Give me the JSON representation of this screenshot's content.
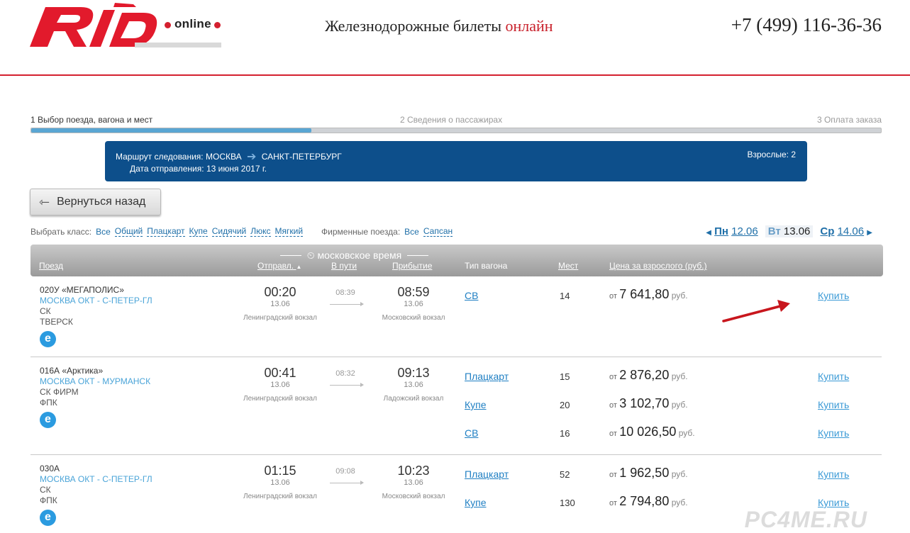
{
  "header": {
    "logo_text": "RЖD",
    "logo_online": "online",
    "tagline_main": "Железнодорожные билеты",
    "tagline_accent": "онлайн",
    "phone": "+7 (499) 116-36-36",
    "accent_color": "#d4202f"
  },
  "steps": {
    "step1": "1 Выбор поезда, вагона и мест",
    "step2": "2 Сведения о пассажирах",
    "step3": "3 Оплата заказа",
    "progress": 0.33
  },
  "route": {
    "label": "Маршрут следования:",
    "from": "МОСКВА",
    "to": "САНКТ-ПЕТЕРБУРГ",
    "date_label": "Дата отправления:",
    "date": "13 июня 2017 г.",
    "pax_label": "Взрослые:",
    "pax": "2"
  },
  "back_button": {
    "label": "Вернуться назад"
  },
  "filters": {
    "class_label": "Выбрать класс:",
    "classes": [
      "Все",
      "Общий",
      "Плацкарт",
      "Купе",
      "Сидячий",
      "Люкс",
      "Мягкий"
    ],
    "branded_label": "Фирменные поезда:",
    "branded": [
      "Все",
      "Сапсан"
    ]
  },
  "dates": {
    "prev_day": "Пн",
    "prev_date": "12.06",
    "cur_day": "Вт",
    "cur_date": "13.06",
    "next_day": "Ср",
    "next_date": "14.06"
  },
  "table": {
    "moscow_time": "московское время",
    "col_train": "Поезд",
    "col_depart": "Отправл.",
    "col_travel": "В пути",
    "col_arrive": "Прибытие",
    "col_wagon": "Тип вагона",
    "col_seats": "Мест",
    "col_price": "Цена за взрослого (руб.)"
  },
  "trains": [
    {
      "name": "020У «МЕГАПОЛИС»",
      "line": "МОСКВА ОКТ - С-ПЕТЕР-ГЛ",
      "sub1": "СК",
      "sub2": "ТВЕРСК",
      "dep_time": "00:20",
      "dep_date": "13.06",
      "dep_station": "Ленинградский вокзал",
      "duration": "08:39",
      "arr_time": "08:59",
      "arr_date": "13.06",
      "arr_station": "Московский вокзал",
      "offers": [
        {
          "wagon": "СВ",
          "seats": "14",
          "from": "от",
          "price": "7 641,80",
          "rub": "руб.",
          "buy": "Купить"
        }
      ]
    },
    {
      "name": "016А «Арктика»",
      "line": "МОСКВА ОКТ - МУРМАНСК",
      "sub1": "СК ФИРМ",
      "sub2": "ФПК",
      "dep_time": "00:41",
      "dep_date": "13.06",
      "dep_station": "Ленинградский вокзал",
      "duration": "08:32",
      "arr_time": "09:13",
      "arr_date": "13.06",
      "arr_station": "Ладожский вокзал",
      "offers": [
        {
          "wagon": "Плацкарт",
          "seats": "15",
          "from": "от",
          "price": "2 876,20",
          "rub": "руб.",
          "buy": "Купить"
        },
        {
          "wagon": "Купе",
          "seats": "20",
          "from": "от",
          "price": "3 102,70",
          "rub": "руб.",
          "buy": "Купить"
        },
        {
          "wagon": "СВ",
          "seats": "16",
          "from": "от",
          "price": "10 026,50",
          "rub": "руб.",
          "buy": "Купить"
        }
      ]
    },
    {
      "name": "030А",
      "line": "МОСКВА ОКТ - С-ПЕТЕР-ГЛ",
      "sub1": "СК",
      "sub2": "ФПК",
      "dep_time": "01:15",
      "dep_date": "13.06",
      "dep_station": "Ленинградский вокзал",
      "duration": "09:08",
      "arr_time": "10:23",
      "arr_date": "13.06",
      "arr_station": "Московский вокзал",
      "offers": [
        {
          "wagon": "Плацкарт",
          "seats": "52",
          "from": "от",
          "price": "1 962,50",
          "rub": "руб.",
          "buy": "Купить"
        },
        {
          "wagon": "Купе",
          "seats": "130",
          "from": "от",
          "price": "2 794,80",
          "rub": "руб.",
          "buy": "Купить"
        }
      ]
    }
  ],
  "e_badge": "e",
  "watermark": "PC4ME.RU"
}
